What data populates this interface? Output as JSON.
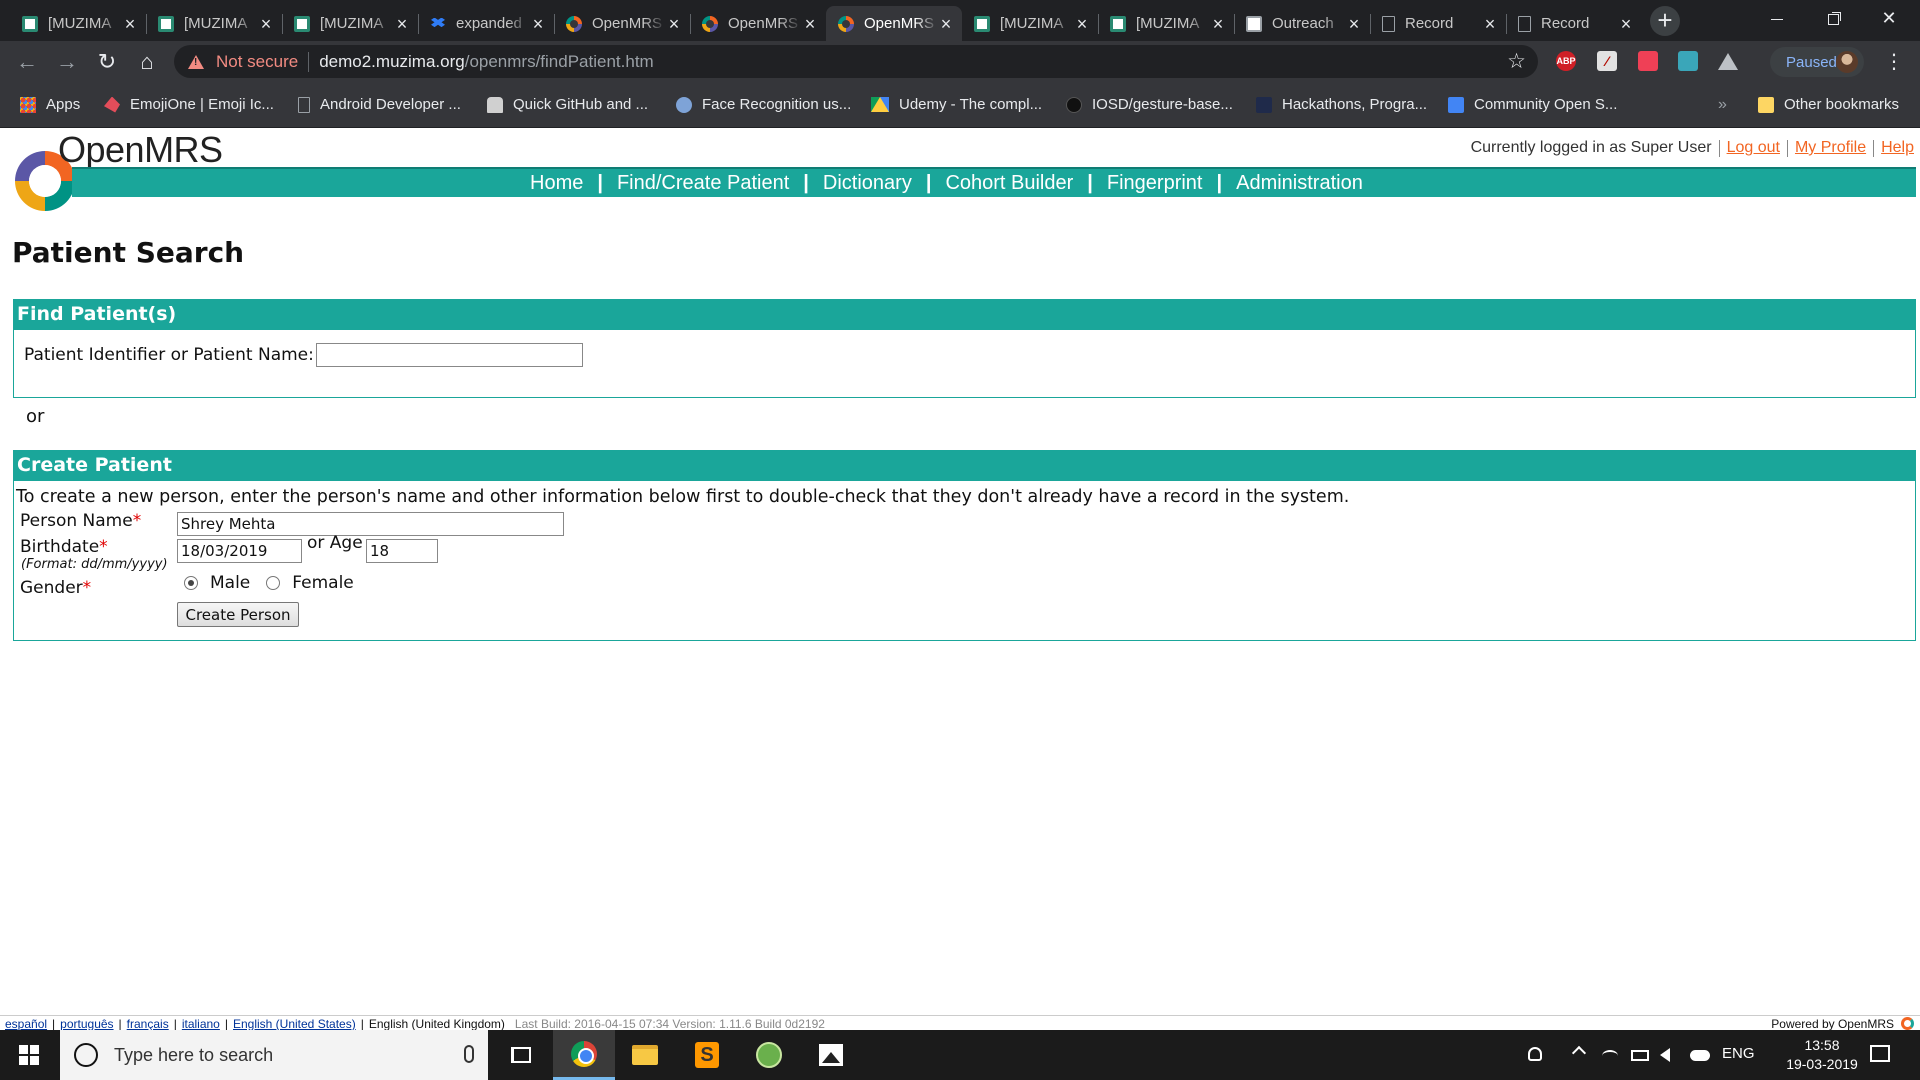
{
  "browser": {
    "tabs": [
      {
        "title": "[MUZIMA",
        "favicon": "muzima",
        "active": false
      },
      {
        "title": "[MUZIMA",
        "favicon": "muzima",
        "active": false
      },
      {
        "title": "[MUZIMA",
        "favicon": "muzima",
        "active": false
      },
      {
        "title": "expanded",
        "favicon": "dropbox",
        "active": false
      },
      {
        "title": "OpenMRS",
        "favicon": "openmrs",
        "active": false
      },
      {
        "title": "OpenMRS",
        "favicon": "openmrs",
        "active": false
      },
      {
        "title": "OpenMRS",
        "favicon": "openmrs",
        "active": true
      },
      {
        "title": "[MUZIMA",
        "favicon": "muzima",
        "active": false
      },
      {
        "title": "[MUZIMA",
        "favicon": "muzima",
        "active": false
      },
      {
        "title": "Outreach",
        "favicon": "outreach",
        "active": false
      },
      {
        "title": "Record",
        "favicon": "doc",
        "active": false
      },
      {
        "title": "Record",
        "favicon": "doc",
        "active": false
      }
    ],
    "security_label": "Not secure",
    "url_host": "demo2.muzima.org",
    "url_path": "/openmrs/findPatient.htm",
    "extensions": {
      "abp": "ABP"
    },
    "profile_status": "Paused",
    "bookmarks": [
      {
        "label": "Apps",
        "icon": "apps"
      },
      {
        "label": "EmojiOne | Emoji Ic...",
        "icon": "emoji"
      },
      {
        "label": "Android Developer ...",
        "icon": "page"
      },
      {
        "label": "Quick GitHub and ...",
        "icon": "github"
      },
      {
        "label": "Face Recognition us...",
        "icon": "brain"
      },
      {
        "label": "Udemy - The compl...",
        "icon": "drive"
      },
      {
        "label": "IOSD/gesture-base...",
        "icon": "dark"
      },
      {
        "label": "Hackathons, Progra...",
        "icon": "h"
      },
      {
        "label": "Community Open S...",
        "icon": "doc"
      }
    ],
    "bookmarks_more": "»",
    "other_bookmarks": "Other bookmarks"
  },
  "header": {
    "logo_text": "OpenMRS",
    "logged_in_text": "Currently logged in as Super User",
    "logout": "Log out",
    "my_profile": "My Profile",
    "help": "Help"
  },
  "nav": [
    "Home",
    "Find/Create Patient",
    "Dictionary",
    "Cohort Builder",
    "Fingerprint",
    "Administration"
  ],
  "page": {
    "title": "Patient Search",
    "find": {
      "header": "Find Patient(s)",
      "label": "Patient Identifier or Patient Name:",
      "value": ""
    },
    "or": "or",
    "create": {
      "header": "Create Patient",
      "intro": "To create a new person, enter the person's name and other information below first to double-check that they don't already have a record in the system.",
      "name_label": "Person Name",
      "name_value": "Shrey Mehta",
      "birthdate_label": "Birthdate",
      "birthdate_format": "(Format: dd/mm/yyyy)",
      "birthdate_value": "18/03/2019",
      "or_age": "or Age",
      "age_value": "18",
      "gender_label": "Gender",
      "required_mark": "*",
      "male": "Male",
      "female": "Female",
      "selected_gender": "Male",
      "button": "Create Person"
    }
  },
  "footer": {
    "languages": [
      "español",
      "português",
      "français",
      "italiano",
      "English (United States)"
    ],
    "current_language": "English (United Kingdom)",
    "build": "Last Build: 2016-04-15 07:34   Version: 1.11.6 Build 0d2192",
    "powered": "Powered by OpenMRS"
  },
  "taskbar": {
    "search_placeholder": "Type here to search",
    "language": "ENG",
    "time": "13:58",
    "date": "19-03-2019"
  },
  "colors": {
    "brand_teal": "#1aa69a",
    "link_orange": "#f26522",
    "required_red": "#e00000"
  }
}
